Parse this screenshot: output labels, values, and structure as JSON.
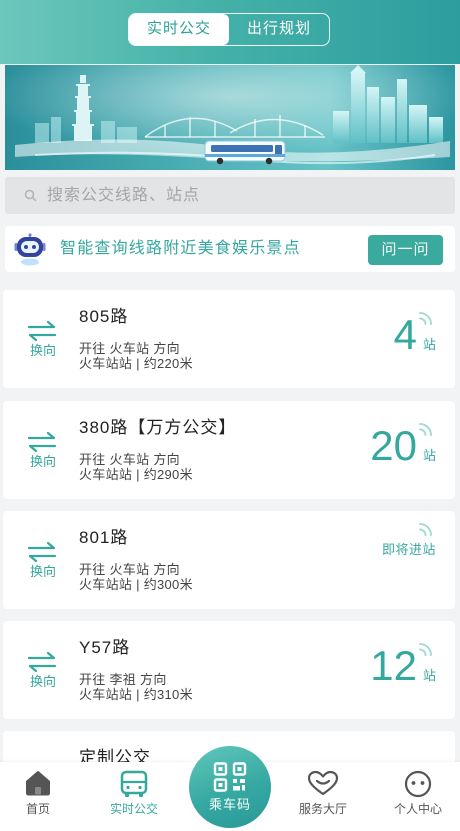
{
  "colors": {
    "accent": "#35a89e",
    "accent_light": "#a6dbd6",
    "text": "#222222",
    "sub": "#444444",
    "muted": "#a5a5a5",
    "bg": "#f2f3f5"
  },
  "header": {
    "tabs": [
      {
        "label": "实时公交",
        "active": true
      },
      {
        "label": "出行规划",
        "active": false
      }
    ]
  },
  "banner": {
    "icon": "city-skyline-bus-illustration"
  },
  "search": {
    "icon": "search-icon",
    "placeholder": "搜索公交线路、站点"
  },
  "assistant": {
    "icon": "robot-icon",
    "text": "智能查询线路附近美食娱乐景点",
    "button_label": "问一问"
  },
  "routes": [
    {
      "name": "805路",
      "swap_label": "换向",
      "direction": "开往 火车站 方向",
      "station": "火车站站 | 约220米",
      "arrival": {
        "stops": "4",
        "unit": "站"
      }
    },
    {
      "name": "380路【万方公交】",
      "swap_label": "换向",
      "direction": "开往 火车站 方向",
      "station": "火车站站 | 约290米",
      "arrival": {
        "stops": "20",
        "unit": "站"
      }
    },
    {
      "name": "801路",
      "swap_label": "换向",
      "direction": "开往 火车站 方向",
      "station": "火车站站 | 约300米",
      "arrival": {
        "status": "即将进站"
      }
    },
    {
      "name": "Y57路",
      "swap_label": "换向",
      "direction": "开往 李祖 方向",
      "station": "火车站站 | 约310米",
      "arrival": {
        "stops": "12",
        "unit": "站"
      }
    },
    {
      "name": "定制公交"
    }
  ],
  "tabbar": {
    "items": [
      {
        "label": "首页",
        "icon": "home-icon",
        "active": false
      },
      {
        "label": "实时公交",
        "icon": "bus-icon",
        "active": true
      },
      {
        "label": "乘车码",
        "icon": "qr-code-icon",
        "active": false
      },
      {
        "label": "服务大厅",
        "icon": "service-heart-icon",
        "active": false
      },
      {
        "label": "个人中心",
        "icon": "smiley-face-icon",
        "active": false
      }
    ]
  }
}
